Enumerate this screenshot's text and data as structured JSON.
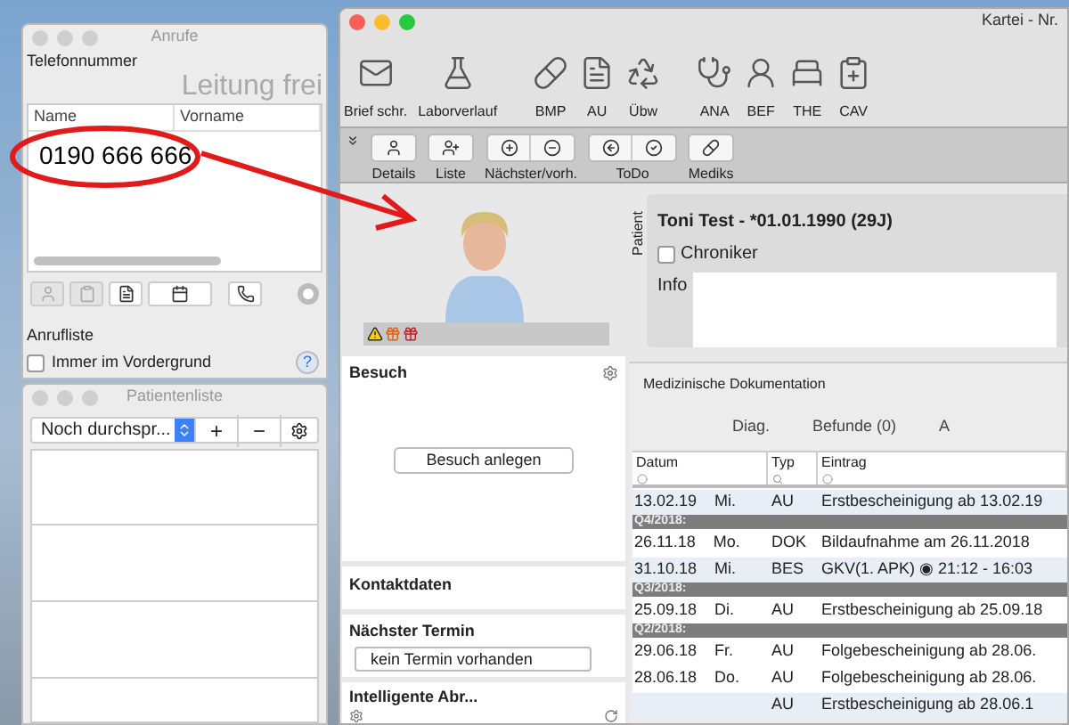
{
  "calls_window": {
    "title": "Anrufe",
    "phone_label": "Telefonnummer",
    "line_status": "Leitung frei",
    "columns": [
      "Name",
      "Vorname"
    ],
    "rows": [
      "0190 666 666"
    ],
    "list_label": "Anrufliste",
    "always_on_top": {
      "label": "Immer im Vordergrund",
      "checked": false
    },
    "help": "?"
  },
  "patient_list_window": {
    "title": "Patientenliste",
    "filter": "Noch durchspr...",
    "add": "+",
    "remove": "−"
  },
  "main_window": {
    "title": "Kartei - Nr.",
    "toolbar": [
      {
        "label": "Brief schr."
      },
      {
        "label": "Laborverlauf"
      },
      {
        "label": "BMP"
      },
      {
        "label": "AU"
      },
      {
        "label": "Übw"
      },
      {
        "label": "ANA"
      },
      {
        "label": "BEF"
      },
      {
        "label": "THE"
      },
      {
        "label": "CAV"
      }
    ],
    "toolbar2": [
      {
        "label": "Details"
      },
      {
        "label": "Liste"
      },
      {
        "label": "Nächster/vorh."
      },
      {
        "label": "ToDo"
      },
      {
        "label": "Mediks"
      }
    ]
  },
  "patient": {
    "side_label": "Patient",
    "name": "Toni Test - *01.01.1990 (29J)",
    "chroniker": {
      "label": "Chroniker",
      "checked": false
    },
    "info_label": "Info"
  },
  "visit_panel": {
    "title": "Besuch",
    "button": "Besuch anlegen"
  },
  "contact_panel": {
    "title": "Kontaktdaten"
  },
  "appointment_panel": {
    "title": "Nächster Termin",
    "value": "kein Termin vorhanden"
  },
  "billing_panel": {
    "title": "Intelligente Abr..."
  },
  "documentation": {
    "tab": "Medizinische Dokumentation",
    "actions": [
      "Diag.",
      "Befunde (0)",
      "A"
    ],
    "columns": [
      "Datum",
      "Typ",
      "Eintrag"
    ],
    "rows": [
      {
        "kind": "entry",
        "date": "13.02.19",
        "day": "Mi.",
        "type": "AU",
        "text": "Erstbescheinigung ab 13.02.19"
      },
      {
        "kind": "quarter",
        "text": "Q4/2018:"
      },
      {
        "kind": "entry",
        "date": "26.11.18",
        "day": "Mo.",
        "type": "DOK",
        "text": "Bildaufnahme am 26.11.2018"
      },
      {
        "kind": "entry",
        "date": "31.10.18",
        "day": "Mi.",
        "type": "BES",
        "text": "GKV(1. APK) ◉ 21:12 - 16:03"
      },
      {
        "kind": "quarter",
        "text": "Q3/2018:"
      },
      {
        "kind": "entry",
        "date": "25.09.18",
        "day": "Di.",
        "type": "AU",
        "text": "Erstbescheinigung ab 25.09.18"
      },
      {
        "kind": "quarter",
        "text": "Q2/2018:"
      },
      {
        "kind": "entry",
        "date": "29.06.18",
        "day": "Fr.",
        "type": "AU",
        "text": "Folgebescheinigung ab 28.06."
      },
      {
        "kind": "entry",
        "date": "28.06.18",
        "day": "Do.",
        "type": "AU",
        "text": "Folgebescheinigung ab 28.06."
      },
      {
        "kind": "entry",
        "type": "AU",
        "text": "Erstbescheinigung ab 28.06.1"
      }
    ]
  }
}
